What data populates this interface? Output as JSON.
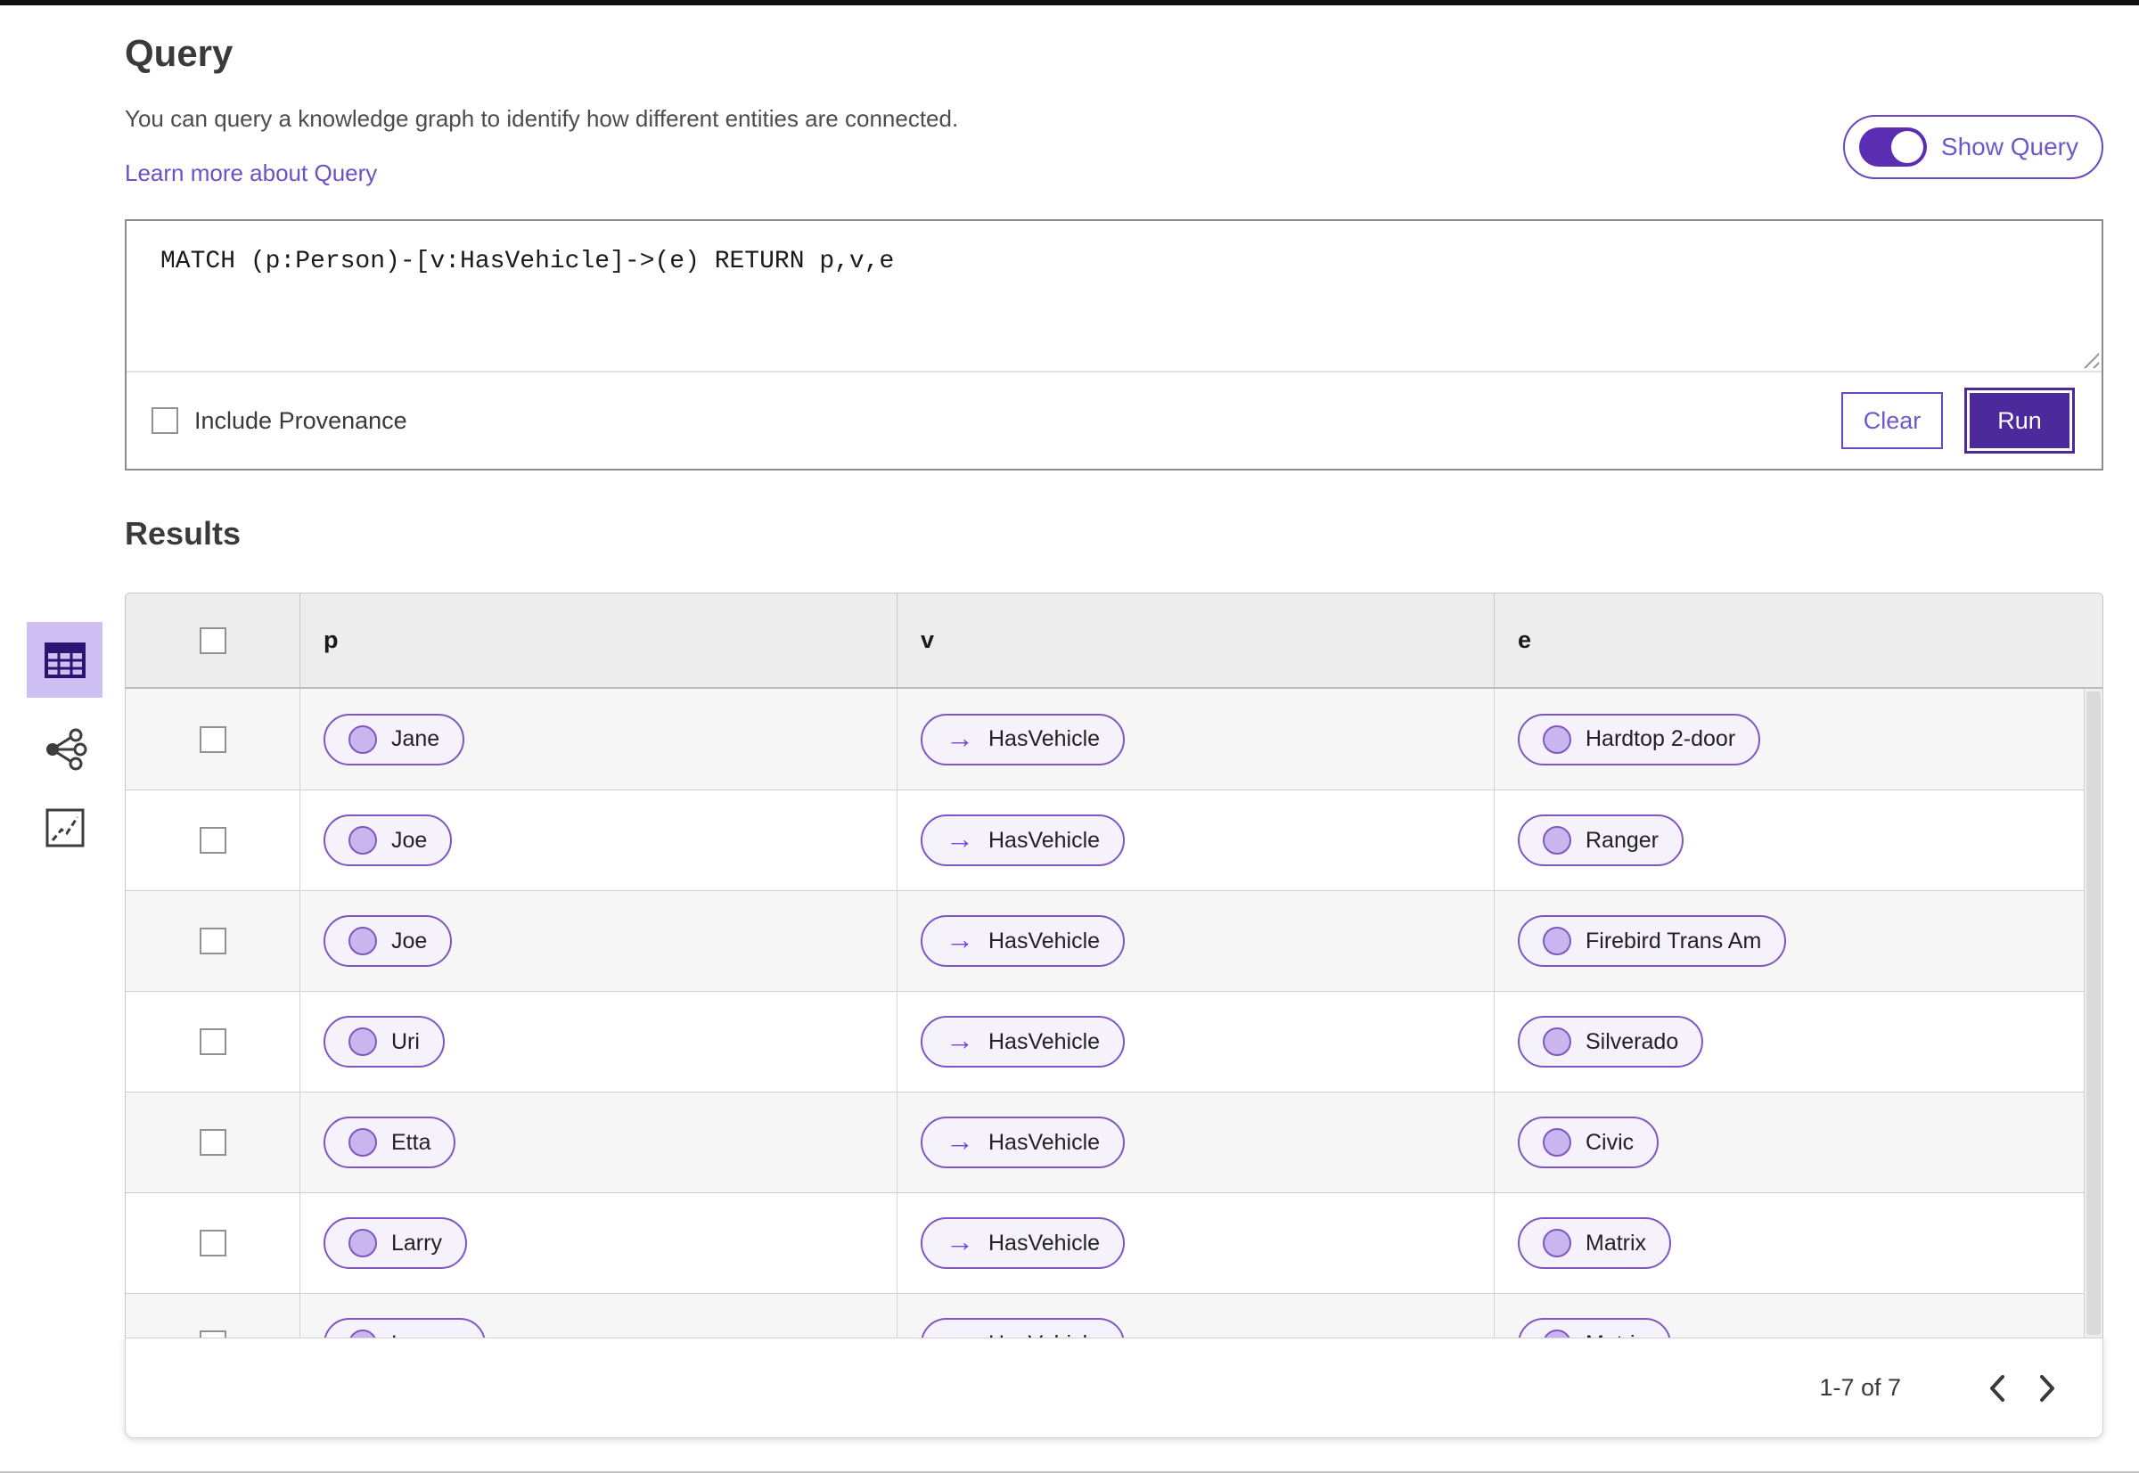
{
  "colors": {
    "accent_purple": "#5b2db3",
    "run_button_bg": "#4c2a9b",
    "outline_purple": "#6b46c1",
    "link_purple": "#6e4fc4",
    "pill_border": "#7e57c2",
    "pill_bg": "#f5f2fc",
    "pill_circle_fill": "#c9b6ee",
    "active_view_bg": "#cfc0f3",
    "active_view_icon": "#2d1472",
    "table_header_bg": "#ededed",
    "zebra_row_bg": "#f6f6f6",
    "top_bar": "#101010"
  },
  "icons": {
    "table_view": "table-grid",
    "graph_view": "network-nodes",
    "chart_view": "line-chart-box",
    "chevron_left": "‹",
    "chevron_right": "›",
    "edge_arrow": "→"
  },
  "query_section": {
    "title": "Query",
    "description": "You can query a knowledge graph to identify how different entities are connected.",
    "learn_more_link": "Learn more about Query",
    "show_query_toggle": {
      "label": "Show Query",
      "state": "on"
    },
    "editor": {
      "value": "MATCH (p:Person)-[v:HasVehicle]->(e) RETURN p,v,e"
    },
    "include_provenance": {
      "label": "Include Provenance",
      "checked": false
    },
    "buttons": {
      "clear": "Clear",
      "run": "Run"
    }
  },
  "results": {
    "title": "Results",
    "active_view": "table-view",
    "columns": [
      "p",
      "v",
      "e"
    ],
    "edge_arrow": "→",
    "rows": [
      {
        "p": "Jane",
        "v": "HasVehicle",
        "e": "Hardtop 2-door"
      },
      {
        "p": "Joe",
        "v": "HasVehicle",
        "e": "Ranger"
      },
      {
        "p": "Joe",
        "v": "HasVehicle",
        "e": "Firebird Trans Am"
      },
      {
        "p": "Uri",
        "v": "HasVehicle",
        "e": "Silverado"
      },
      {
        "p": "Etta",
        "v": "HasVehicle",
        "e": "Civic"
      },
      {
        "p": "Larry",
        "v": "HasVehicle",
        "e": "Matrix"
      },
      {
        "p": "Lauren",
        "v": "HasVehicle",
        "e": "Matrix"
      }
    ],
    "pagination": {
      "range_label": "1-7 of 7"
    }
  }
}
